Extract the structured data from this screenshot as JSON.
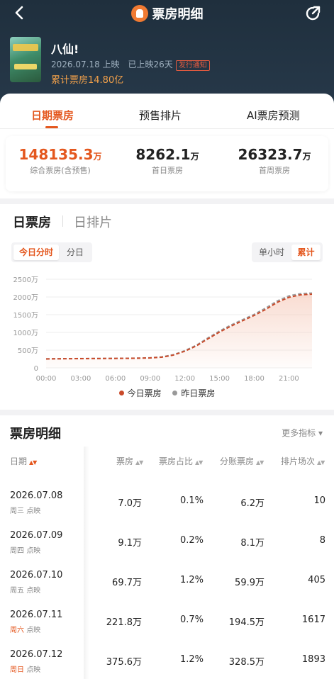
{
  "header": {
    "title": "票房明细",
    "movie_name": "八仙!",
    "release_info": "2026.07.18 上映",
    "days_info": "已上映26天",
    "badge": "发行通知",
    "cumulative": "累计票房14.80亿"
  },
  "tabs": [
    "日期票房",
    "预售排片",
    "AI票房预测"
  ],
  "stats": [
    {
      "value": "148135.3",
      "unit": "万",
      "label": "综合票房(含预售)"
    },
    {
      "value": "8262.1",
      "unit": "万",
      "label": "首日票房"
    },
    {
      "value": "26323.7",
      "unit": "万",
      "label": "首周票房"
    }
  ],
  "section_tabs": [
    "日票房",
    "日排片"
  ],
  "segment_left": [
    "今日分时",
    "分日"
  ],
  "segment_right": [
    "单小时",
    "累计"
  ],
  "colors": {
    "accent": "#e4571e",
    "today": "#c94a2a",
    "yesterday": "#999999"
  },
  "chart_data": {
    "type": "line",
    "x": [
      "00:00",
      "01:00",
      "02:00",
      "03:00",
      "04:00",
      "05:00",
      "06:00",
      "07:00",
      "08:00",
      "09:00",
      "10:00",
      "11:00",
      "12:00",
      "13:00",
      "14:00",
      "15:00",
      "16:00",
      "17:00",
      "18:00",
      "19:00",
      "20:00",
      "21:00",
      "22:00",
      "23:00"
    ],
    "xticks": [
      "00:00",
      "03:00",
      "06:00",
      "09:00",
      "12:00",
      "15:00",
      "18:00",
      "21:00"
    ],
    "yticks": [
      "0",
      "500万",
      "1000万",
      "1500万",
      "2000万",
      "2500万"
    ],
    "ylim": [
      0,
      2500
    ],
    "series": [
      {
        "name": "今日票房",
        "values": [
          250,
          255,
          258,
          260,
          262,
          264,
          266,
          268,
          272,
          280,
          300,
          360,
          470,
          620,
          820,
          1010,
          1180,
          1330,
          1480,
          1650,
          1850,
          1990,
          2060,
          2080
        ]
      },
      {
        "name": "昨日票房",
        "values": [
          255,
          258,
          260,
          262,
          264,
          266,
          268,
          270,
          275,
          285,
          310,
          370,
          485,
          640,
          845,
          1040,
          1210,
          1360,
          1510,
          1690,
          1890,
          2030,
          2095,
          2110
        ]
      }
    ],
    "legend": [
      "今日票房",
      "昨日票房"
    ]
  },
  "table": {
    "title": "票房明细",
    "more": "更多指标",
    "headers": [
      "日期",
      "票房",
      "票房占比",
      "分账票房",
      "排片场次"
    ],
    "rows": [
      {
        "date": "2026.07.08",
        "week": "周三",
        "tag": "点映",
        "weekend": false,
        "box": "7.0万",
        "share": "0.1%",
        "split": "6.2万",
        "shows": "10"
      },
      {
        "date": "2026.07.09",
        "week": "周四",
        "tag": "点映",
        "weekend": false,
        "box": "9.1万",
        "share": "0.2%",
        "split": "8.1万",
        "shows": "8"
      },
      {
        "date": "2026.07.10",
        "week": "周五",
        "tag": "点映",
        "weekend": false,
        "box": "69.7万",
        "share": "1.2%",
        "split": "59.9万",
        "shows": "405"
      },
      {
        "date": "2026.07.11",
        "week": "周六",
        "tag": "点映",
        "weekend": true,
        "box": "221.8万",
        "share": "0.7%",
        "split": "194.5万",
        "shows": "1617"
      },
      {
        "date": "2026.07.12",
        "week": "周日",
        "tag": "点映",
        "weekend": true,
        "box": "375.6万",
        "share": "1.2%",
        "split": "328.5万",
        "shows": "1893"
      }
    ]
  }
}
